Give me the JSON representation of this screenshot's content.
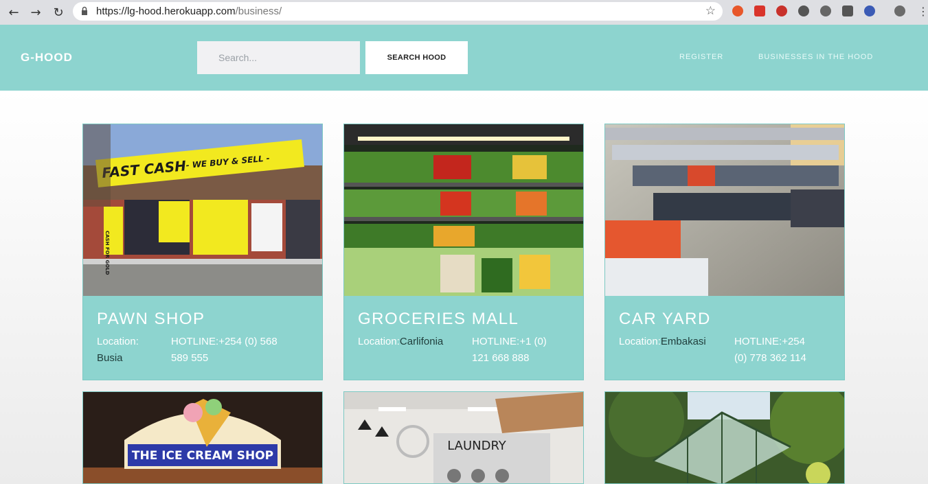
{
  "browser": {
    "url_host": "https://lg-hood.herokuapp.com",
    "url_path": "/business/"
  },
  "header": {
    "brand": "G-HOOD",
    "search_placeholder": "Search...",
    "search_button": "SEARCH HOOD",
    "nav": [
      "REGISTER",
      "BUSINESSES IN THE HOOD"
    ]
  },
  "cards": [
    {
      "title": "PAWN SHOP",
      "location_label": "Location:",
      "location": "Busia",
      "hotline_label": "HOTLINE:",
      "hotline_1": "+254 (0) 568",
      "hotline_2": "589 555"
    },
    {
      "title": "GROCERIES MALL",
      "location_label": "Location:",
      "location": "Carlifonia",
      "hotline_label": "HOTLINE:",
      "hotline_1": "+1 (0)",
      "hotline_2": "121 668 888"
    },
    {
      "title": "CAR YARD",
      "location_label": "Location:",
      "location": "Embakasi",
      "hotline_label": "HOTLINE:",
      "hotline_1": "+254",
      "hotline_2": "(0) 778 362 114"
    }
  ],
  "images": {
    "pawn_sign_1": "FAST CASH",
    "pawn_sign_2": "- WE BUY & SELL -",
    "pawn_sign_3": "CASH FOR GOLD",
    "ice_cream_sign": "THE ICE CREAM SHOP",
    "laundry_sign": "LAUNDRY"
  }
}
